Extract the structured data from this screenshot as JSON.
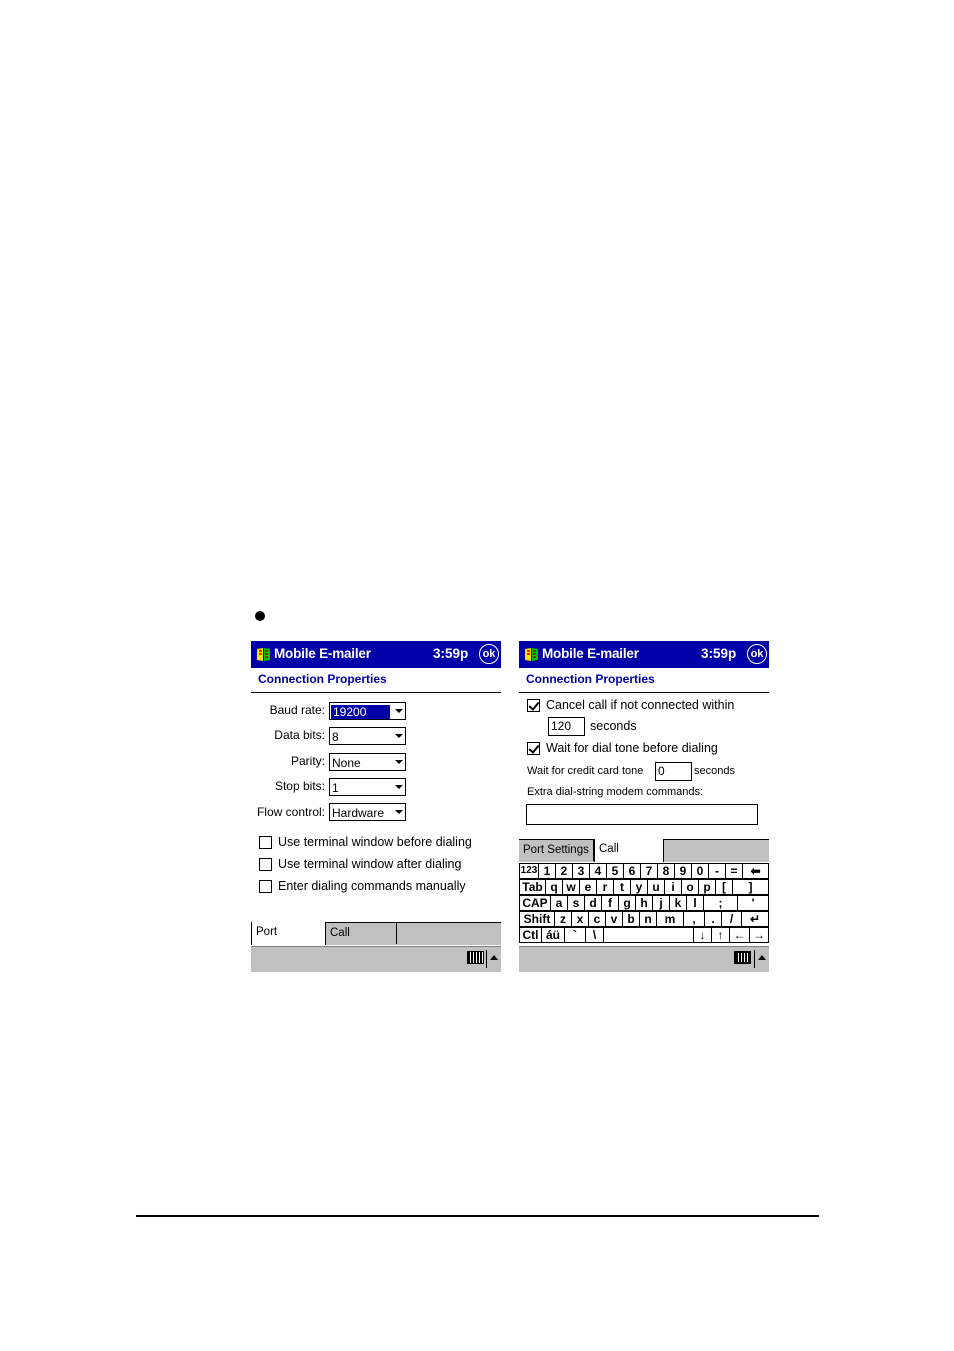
{
  "left_screen": {
    "app_title": "Mobile E-mailer",
    "clock": "3:59p",
    "ok_label": "ok",
    "heading": "Connection Properties",
    "fields": [
      {
        "label": "Baud rate:",
        "value": "19200"
      },
      {
        "label": "Data bits:",
        "value": "8"
      },
      {
        "label": "Parity:",
        "value": "None"
      },
      {
        "label": "Stop bits:",
        "value": "1"
      },
      {
        "label": "Flow control:",
        "value": "Hardware"
      }
    ],
    "options": [
      {
        "label": "Use terminal window before dialing",
        "checked": false
      },
      {
        "label": "Use terminal window after dialing",
        "checked": false
      },
      {
        "label": "Enter dialing commands manually",
        "checked": false
      }
    ],
    "tabs": [
      "Port Settings",
      "Call Options"
    ],
    "active_tab": "Port Settings"
  },
  "right_screen": {
    "app_title": "Mobile E-mailer",
    "clock": "3:59p",
    "ok_label": "ok",
    "heading": "Connection Properties",
    "cancel_call_label": "Cancel call if not connected within",
    "cancel_call_checked": true,
    "cancel_seconds_value": "120",
    "seconds_label": "seconds",
    "wait_dial_tone_label": "Wait for dial tone before dialing",
    "wait_dial_tone_checked": true,
    "credit_card_label": "Wait for credit card tone",
    "credit_card_value": "0",
    "credit_seconds_label": "seconds",
    "extra_commands_label": "Extra dial-string modem commands:",
    "extra_commands_value": "",
    "tabs": [
      "Port Settings",
      "Call Options"
    ],
    "active_tab": "Call Options",
    "keyboard": {
      "row1": [
        "123",
        "1",
        "2",
        "3",
        "4",
        "5",
        "6",
        "7",
        "8",
        "9",
        "0",
        "-",
        "=",
        "⬅"
      ],
      "row2": [
        "Tab",
        "q",
        "w",
        "e",
        "r",
        "t",
        "y",
        "u",
        "i",
        "o",
        "p",
        "[",
        "]"
      ],
      "row3": [
        "CAP",
        "a",
        "s",
        "d",
        "f",
        "g",
        "h",
        "j",
        "k",
        "l",
        ";",
        "'"
      ],
      "row4": [
        "Shift",
        "z",
        "x",
        "c",
        "v",
        "b",
        "n",
        "m",
        ",",
        ".",
        "/",
        "↵"
      ],
      "row5": [
        "Ctl",
        "áü",
        "`",
        "\\",
        "",
        "↓",
        "↑",
        "←",
        "→"
      ]
    }
  },
  "colors": {
    "titlebar": "#0000a8",
    "bar_gray": "#c0c0c0",
    "heading": "#0000a8"
  }
}
